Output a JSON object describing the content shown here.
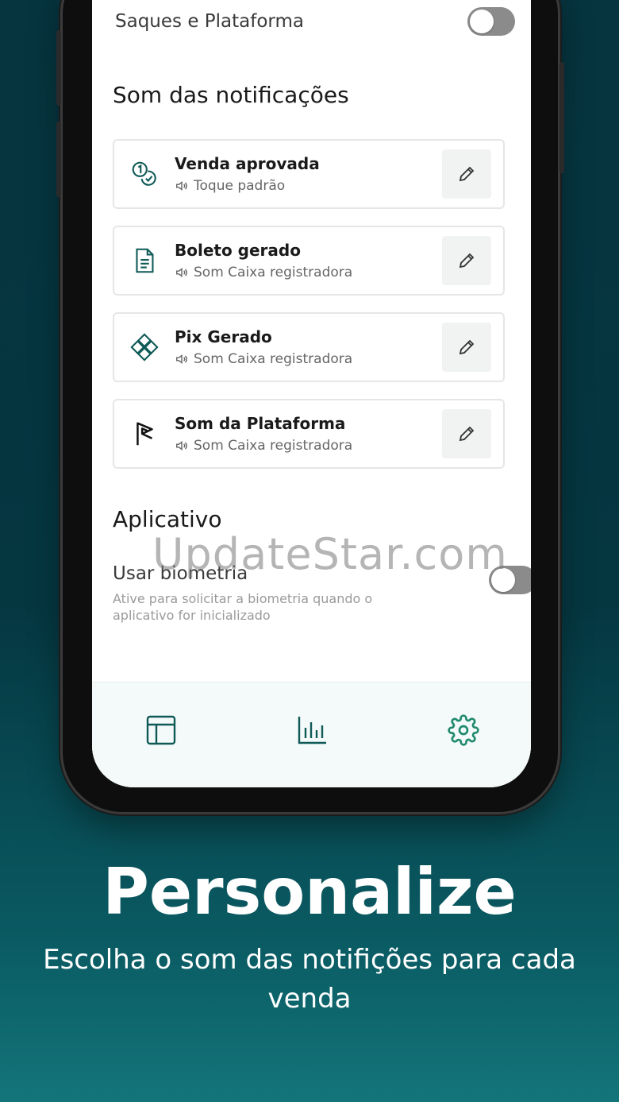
{
  "settings": {
    "withdrawals_toggle": {
      "label": "Saques e Plataforma",
      "on": false
    },
    "sound_section_title": "Som das notificações",
    "sound_cards": [
      {
        "title": "Venda aprovada",
        "sound": "Toque padrão",
        "icon": "coins-icon"
      },
      {
        "title": "Boleto gerado",
        "sound": "Som Caixa registradora",
        "icon": "document-icon"
      },
      {
        "title": "Pix Gerado",
        "sound": "Som Caixa registradora",
        "icon": "pix-icon"
      },
      {
        "title": "Som da Plataforma",
        "sound": "Som Caixa registradora",
        "icon": "platform-logo-icon"
      }
    ],
    "app_section_title": "Aplicativo",
    "biometry": {
      "label": "Usar biometria",
      "description": "Ative para solicitar a biometria quando o aplicativo for inicializado",
      "on": false
    }
  },
  "tabbar": {
    "tabs": [
      {
        "icon": "dashboard-icon",
        "active": false
      },
      {
        "icon": "bar-chart-icon",
        "active": false
      },
      {
        "icon": "gear-icon",
        "active": true
      }
    ]
  },
  "watermark": "UpdateStar.com",
  "promo": {
    "headline": "Personalize",
    "subline": "Escolha o som das notifições para cada venda"
  },
  "colors": {
    "accent": "#1f8a6e",
    "icon_dark": "#0f5a57",
    "background_top": "#06343f",
    "background_bottom": "#13757a"
  }
}
